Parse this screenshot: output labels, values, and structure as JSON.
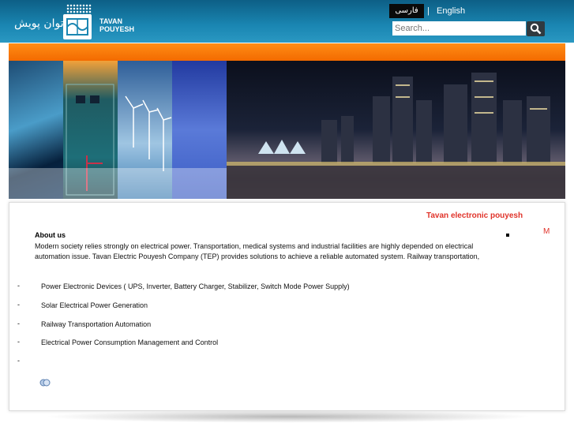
{
  "header": {
    "logo_fa": "توان پویش",
    "logo_en_line1": "TAVAN",
    "logo_en_line2": "POUYESH",
    "lang_fa": "فارسی",
    "lang_separator": "|",
    "lang_en": "English",
    "search": {
      "placeholder": "Search..."
    }
  },
  "colors": {
    "header": "#1a86b2",
    "orange_bar": "#f36a00",
    "accent_red": "#e0332a"
  },
  "content": {
    "site_title": "Tavan electronic pouyesh",
    "side_letter": "M",
    "about_heading": "About us",
    "about_text": "Modern society relies strongly on electrical power. Transportation, medical systems and industrial facilities are highly depended on electrical automation issue.  Tavan Electric Pouyesh Company (TEP) provides solutions to achieve a reliable automated system. Railway transportation,",
    "list": [
      {
        "dash": "-",
        "text": "Power Electronic Devices ( UPS, Inverter, Battery Charger, Stabilizer, Switch Mode Power Supply)"
      },
      {
        "dash": "-",
        "text": "Solar Electrical Power Generation"
      },
      {
        "dash": "-",
        "text": "Railway Transportation Automation"
      },
      {
        "dash": "-",
        "text": "Electrical Power Consumption Management and Control"
      },
      {
        "dash": "-",
        "text": ""
      }
    ],
    "icons": {
      "search": "magnifier-icon",
      "footer": "translate-icon"
    }
  }
}
